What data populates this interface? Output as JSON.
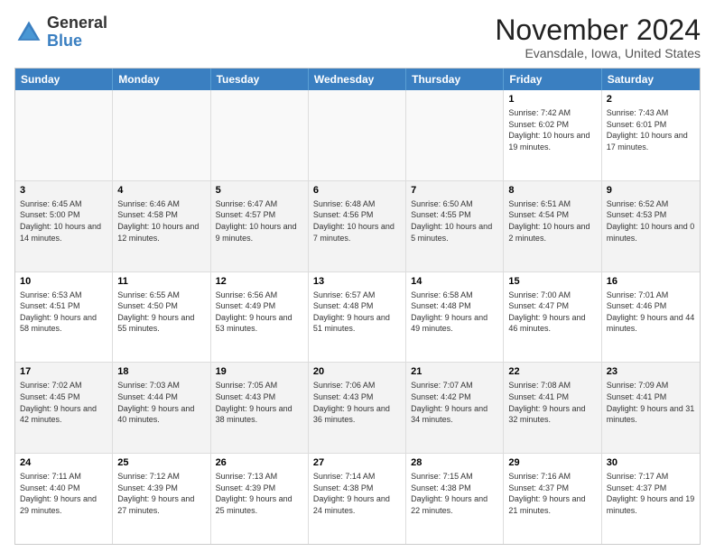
{
  "header": {
    "logo_general": "General",
    "logo_blue": "Blue",
    "month_title": "November 2024",
    "location": "Evansdale, Iowa, United States"
  },
  "weekdays": [
    "Sunday",
    "Monday",
    "Tuesday",
    "Wednesday",
    "Thursday",
    "Friday",
    "Saturday"
  ],
  "rows": [
    [
      {
        "day": "",
        "info": "",
        "empty": true
      },
      {
        "day": "",
        "info": "",
        "empty": true
      },
      {
        "day": "",
        "info": "",
        "empty": true
      },
      {
        "day": "",
        "info": "",
        "empty": true
      },
      {
        "day": "",
        "info": "",
        "empty": true
      },
      {
        "day": "1",
        "info": "Sunrise: 7:42 AM\nSunset: 6:02 PM\nDaylight: 10 hours and 19 minutes.",
        "empty": false
      },
      {
        "day": "2",
        "info": "Sunrise: 7:43 AM\nSunset: 6:01 PM\nDaylight: 10 hours and 17 minutes.",
        "empty": false
      }
    ],
    [
      {
        "day": "3",
        "info": "Sunrise: 6:45 AM\nSunset: 5:00 PM\nDaylight: 10 hours and 14 minutes.",
        "empty": false
      },
      {
        "day": "4",
        "info": "Sunrise: 6:46 AM\nSunset: 4:58 PM\nDaylight: 10 hours and 12 minutes.",
        "empty": false
      },
      {
        "day": "5",
        "info": "Sunrise: 6:47 AM\nSunset: 4:57 PM\nDaylight: 10 hours and 9 minutes.",
        "empty": false
      },
      {
        "day": "6",
        "info": "Sunrise: 6:48 AM\nSunset: 4:56 PM\nDaylight: 10 hours and 7 minutes.",
        "empty": false
      },
      {
        "day": "7",
        "info": "Sunrise: 6:50 AM\nSunset: 4:55 PM\nDaylight: 10 hours and 5 minutes.",
        "empty": false
      },
      {
        "day": "8",
        "info": "Sunrise: 6:51 AM\nSunset: 4:54 PM\nDaylight: 10 hours and 2 minutes.",
        "empty": false
      },
      {
        "day": "9",
        "info": "Sunrise: 6:52 AM\nSunset: 4:53 PM\nDaylight: 10 hours and 0 minutes.",
        "empty": false
      }
    ],
    [
      {
        "day": "10",
        "info": "Sunrise: 6:53 AM\nSunset: 4:51 PM\nDaylight: 9 hours and 58 minutes.",
        "empty": false
      },
      {
        "day": "11",
        "info": "Sunrise: 6:55 AM\nSunset: 4:50 PM\nDaylight: 9 hours and 55 minutes.",
        "empty": false
      },
      {
        "day": "12",
        "info": "Sunrise: 6:56 AM\nSunset: 4:49 PM\nDaylight: 9 hours and 53 minutes.",
        "empty": false
      },
      {
        "day": "13",
        "info": "Sunrise: 6:57 AM\nSunset: 4:48 PM\nDaylight: 9 hours and 51 minutes.",
        "empty": false
      },
      {
        "day": "14",
        "info": "Sunrise: 6:58 AM\nSunset: 4:48 PM\nDaylight: 9 hours and 49 minutes.",
        "empty": false
      },
      {
        "day": "15",
        "info": "Sunrise: 7:00 AM\nSunset: 4:47 PM\nDaylight: 9 hours and 46 minutes.",
        "empty": false
      },
      {
        "day": "16",
        "info": "Sunrise: 7:01 AM\nSunset: 4:46 PM\nDaylight: 9 hours and 44 minutes.",
        "empty": false
      }
    ],
    [
      {
        "day": "17",
        "info": "Sunrise: 7:02 AM\nSunset: 4:45 PM\nDaylight: 9 hours and 42 minutes.",
        "empty": false
      },
      {
        "day": "18",
        "info": "Sunrise: 7:03 AM\nSunset: 4:44 PM\nDaylight: 9 hours and 40 minutes.",
        "empty": false
      },
      {
        "day": "19",
        "info": "Sunrise: 7:05 AM\nSunset: 4:43 PM\nDaylight: 9 hours and 38 minutes.",
        "empty": false
      },
      {
        "day": "20",
        "info": "Sunrise: 7:06 AM\nSunset: 4:43 PM\nDaylight: 9 hours and 36 minutes.",
        "empty": false
      },
      {
        "day": "21",
        "info": "Sunrise: 7:07 AM\nSunset: 4:42 PM\nDaylight: 9 hours and 34 minutes.",
        "empty": false
      },
      {
        "day": "22",
        "info": "Sunrise: 7:08 AM\nSunset: 4:41 PM\nDaylight: 9 hours and 32 minutes.",
        "empty": false
      },
      {
        "day": "23",
        "info": "Sunrise: 7:09 AM\nSunset: 4:41 PM\nDaylight: 9 hours and 31 minutes.",
        "empty": false
      }
    ],
    [
      {
        "day": "24",
        "info": "Sunrise: 7:11 AM\nSunset: 4:40 PM\nDaylight: 9 hours and 29 minutes.",
        "empty": false
      },
      {
        "day": "25",
        "info": "Sunrise: 7:12 AM\nSunset: 4:39 PM\nDaylight: 9 hours and 27 minutes.",
        "empty": false
      },
      {
        "day": "26",
        "info": "Sunrise: 7:13 AM\nSunset: 4:39 PM\nDaylight: 9 hours and 25 minutes.",
        "empty": false
      },
      {
        "day": "27",
        "info": "Sunrise: 7:14 AM\nSunset: 4:38 PM\nDaylight: 9 hours and 24 minutes.",
        "empty": false
      },
      {
        "day": "28",
        "info": "Sunrise: 7:15 AM\nSunset: 4:38 PM\nDaylight: 9 hours and 22 minutes.",
        "empty": false
      },
      {
        "day": "29",
        "info": "Sunrise: 7:16 AM\nSunset: 4:37 PM\nDaylight: 9 hours and 21 minutes.",
        "empty": false
      },
      {
        "day": "30",
        "info": "Sunrise: 7:17 AM\nSunset: 4:37 PM\nDaylight: 9 hours and 19 minutes.",
        "empty": false
      }
    ]
  ]
}
